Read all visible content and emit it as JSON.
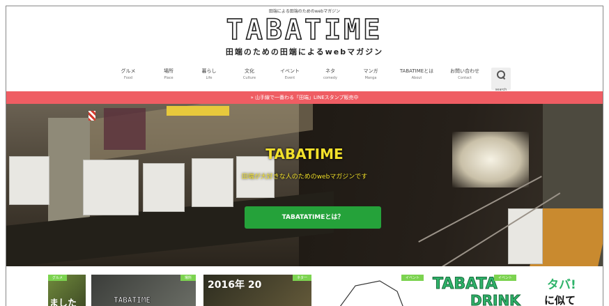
{
  "header": {
    "tagline": "田端による田端のためのwebマガジン",
    "logo": "TABATIME",
    "logo_sub": "田端のための田端によるwebマガジン"
  },
  "nav": {
    "items": [
      {
        "label": "グルメ",
        "en": "Food"
      },
      {
        "label": "場所",
        "en": "Place"
      },
      {
        "label": "暮らし",
        "en": "Life"
      },
      {
        "label": "文化",
        "en": "Culture"
      },
      {
        "label": "イベント",
        "en": "Event"
      },
      {
        "label": "ネタ",
        "en": "comedy"
      },
      {
        "label": "マンガ",
        "en": "Manga"
      },
      {
        "label": "TABATIMEとは",
        "en": "About"
      },
      {
        "label": "お問い合わせ",
        "en": "Contact"
      }
    ],
    "search_label": "search",
    "search_icon": "search-icon"
  },
  "banner": {
    "text": "» 山手線で一番わる「田端」LINEスタンプ販売中"
  },
  "hero": {
    "title": "TABATIME",
    "subtitle": "田端が大好きな人のためのwebマガジンです",
    "button": "TABATATIMEとは？"
  },
  "cards": [
    {
      "tag": "グルメ",
      "text": "ました"
    },
    {
      "tag": "場所",
      "text": "TABATIME"
    },
    {
      "tag": "ネタ一",
      "text": "2016年 20"
    },
    {
      "tag": "イベント"
    },
    {
      "tag": "イベント",
      "text1": "TABATA",
      "text2": "DRINK"
    },
    {
      "text1": "タバ!",
      "text2": "に似て"
    }
  ],
  "colors": {
    "banner": "#ef5d63",
    "button": "#25a23a",
    "hero_text": "#f3e12b",
    "tag": "#7cd350"
  }
}
